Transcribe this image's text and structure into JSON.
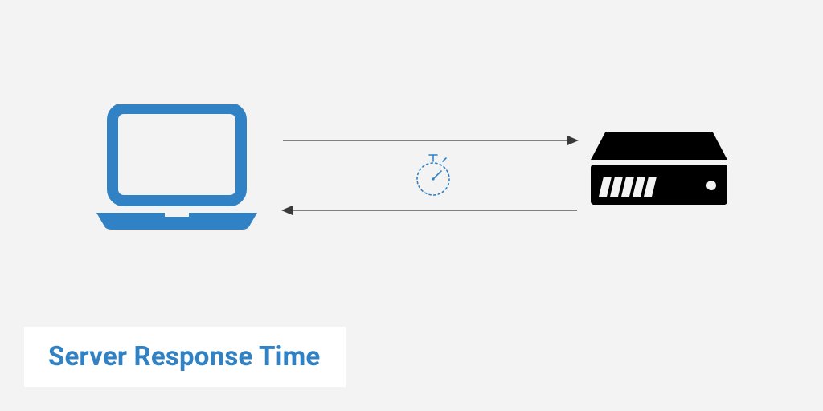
{
  "title": "Server Response Time",
  "icons": {
    "client": "laptop-icon",
    "server": "server-icon",
    "timer": "stopwatch-icon"
  },
  "colors": {
    "accent": "#3182c4",
    "serverFill": "#000000",
    "arrowStroke": "#3a3a3a",
    "background": "#f3f3f3",
    "panel": "#ffffff"
  },
  "arrows": {
    "request": "client-to-server",
    "response": "server-to-client"
  }
}
